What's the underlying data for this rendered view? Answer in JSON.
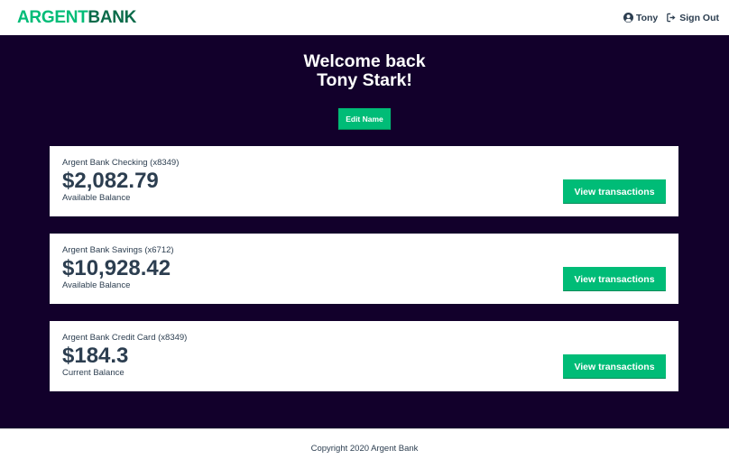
{
  "brand": {
    "part1": "ARGENT",
    "part2": "BANK"
  },
  "nav": {
    "user_icon": "user-circle-icon",
    "user_label": "Tony",
    "signout_icon": "sign-out-icon",
    "signout_label": "Sign Out"
  },
  "header": {
    "welcome_line1": "Welcome back",
    "welcome_line2": "Tony Stark!",
    "edit_label": "Edit Name"
  },
  "accounts": [
    {
      "title": "Argent Bank Checking (x8349)",
      "amount": "$2,082.79",
      "description": "Available Balance",
      "button": "View transactions"
    },
    {
      "title": "Argent Bank Savings (x6712)",
      "amount": "$10,928.42",
      "description": "Available Balance",
      "button": "View transactions"
    },
    {
      "title": "Argent Bank Credit Card (x8349)",
      "amount": "$184.3",
      "description": "Current Balance",
      "button": "View transactions"
    }
  ],
  "footer": {
    "copyright": "Copyright 2020 Argent Bank"
  },
  "colors": {
    "accent": "#00bc77",
    "brand_dark": "#0a6b4a",
    "background_dark": "#12002b",
    "text": "#2c3e50"
  }
}
